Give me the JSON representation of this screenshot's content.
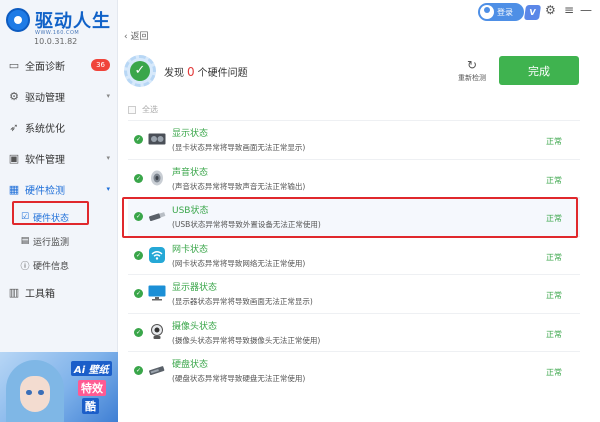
{
  "app": {
    "logo_text": "驱动人生",
    "logo_sub": "WWW.160.COM",
    "version": "10.0.31.82"
  },
  "sidebar": {
    "items": [
      {
        "label": "全面诊断",
        "icon": "monitor-icon",
        "badge": "36"
      },
      {
        "label": "驱动管理",
        "icon": "gear-icon"
      },
      {
        "label": "系统优化",
        "icon": "rocket-icon"
      },
      {
        "label": "软件管理",
        "icon": "box-icon"
      },
      {
        "label": "硬件检测",
        "icon": "chip-icon"
      }
    ],
    "sub_items": [
      {
        "label": "硬件状态",
        "icon": "status-icon"
      },
      {
        "label": "运行监测",
        "icon": "chart-icon"
      },
      {
        "label": "硬件信息",
        "icon": "info-icon"
      }
    ],
    "toolbox": {
      "label": "工具箱",
      "icon": "toolbox-icon"
    },
    "banner": {
      "line1": "Ai 壁纸",
      "line2": "特效",
      "line3": "酷"
    }
  },
  "topbar": {
    "login_label": "登录",
    "vip_label": "V"
  },
  "main": {
    "back_label": "返回",
    "summary_prefix": "发现",
    "summary_count": "0",
    "summary_suffix": "个硬件问题",
    "rescan_label": "重新检测",
    "done_label": "完成",
    "select_all_label": "全选"
  },
  "devices": [
    {
      "name": "显示状态",
      "desc": "(显卡状态异常将导致画面无法正常显示)",
      "status": "正常",
      "icon": "graphics-card-icon"
    },
    {
      "name": "声音状态",
      "desc": "(声音状态异常将导致声音无法正常输出)",
      "status": "正常",
      "icon": "speaker-icon"
    },
    {
      "name": "USB状态",
      "desc": "(USB状态异常将导致外置设备无法正常使用)",
      "status": "正常",
      "icon": "usb-drive-icon"
    },
    {
      "name": "网卡状态",
      "desc": "(网卡状态异常将导致网络无法正常使用)",
      "status": "正常",
      "icon": "wifi-icon"
    },
    {
      "name": "显示器状态",
      "desc": "(显示器状态异常将导致画面无法正常显示)",
      "status": "正常",
      "icon": "monitor-icon"
    },
    {
      "name": "摄像头状态",
      "desc": "(摄像头状态异常将导致摄像头无法正常使用)",
      "status": "正常",
      "icon": "webcam-icon"
    },
    {
      "name": "硬盘状态",
      "desc": "(硬盘状态异常将导致硬盘无法正常使用)",
      "status": "正常",
      "icon": "hard-drive-icon"
    }
  ],
  "colors": {
    "accent": "#1e6fd9",
    "ok": "#3aa64a",
    "danger": "#e23a3a",
    "highlight": "#e0282c"
  }
}
